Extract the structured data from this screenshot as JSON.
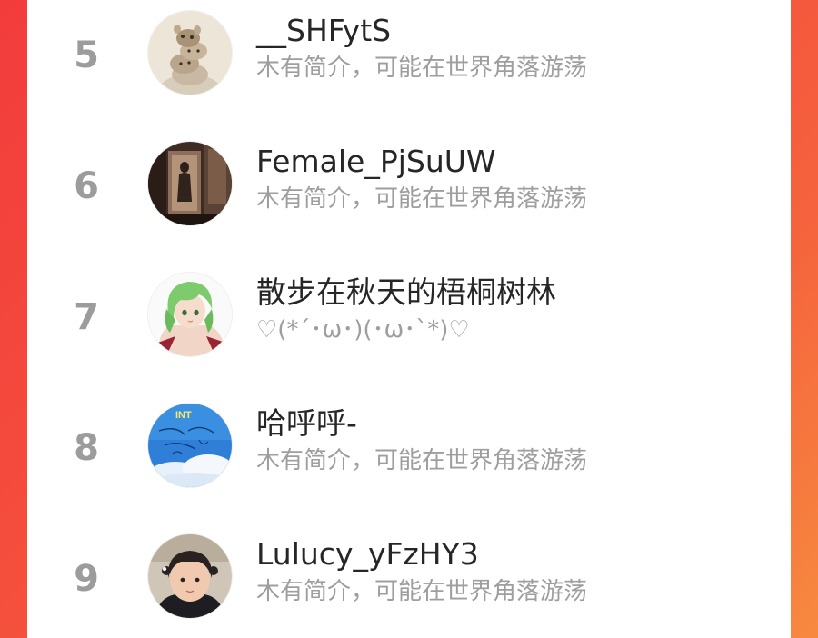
{
  "ranking": {
    "entries": [
      {
        "rank": "5",
        "name": "__SHFytS",
        "bio": "木有简介，可能在世界角落游荡",
        "avatar": "hamster-stack-avatar"
      },
      {
        "rank": "6",
        "name": "Female_PjSuUW",
        "bio": "木有简介，可能在世界角落游荡",
        "avatar": "room-silhouette-avatar"
      },
      {
        "rank": "7",
        "name": "散步在秋天的梧桐树林",
        "bio": "♡(*´･ω･)(･ω･`*)♡",
        "avatar": "green-hair-anime-avatar"
      },
      {
        "rank": "8",
        "name": "哈呼呼-",
        "bio": "木有简介，可能在世界角落游荡",
        "avatar": "blue-sky-sketch-avatar"
      },
      {
        "rank": "9",
        "name": "Lulucy_yFzHY3",
        "bio": "木有简介，可能在世界角落游荡",
        "avatar": "girl-photo-avatar"
      }
    ]
  }
}
